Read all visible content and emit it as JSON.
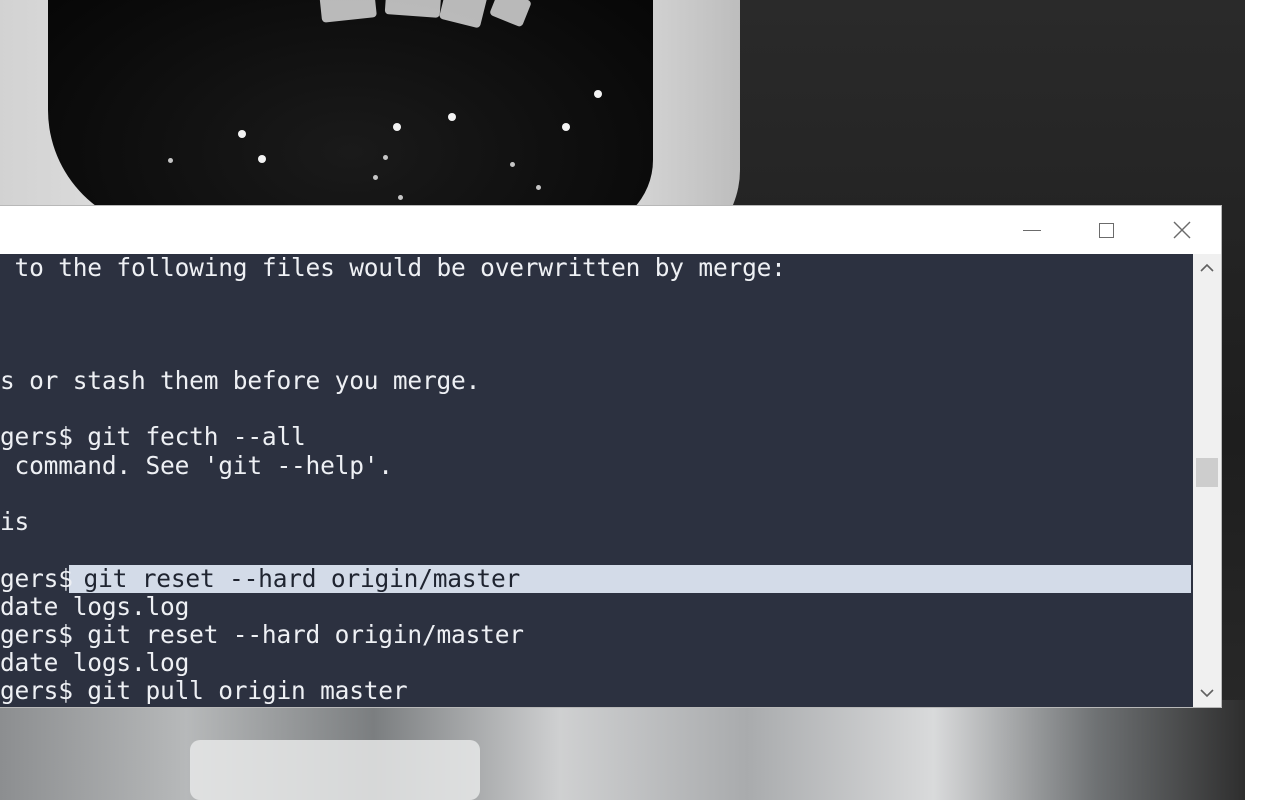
{
  "wallpaper": {
    "subject": "astronaut-helmet"
  },
  "terminal": {
    "window_controls": {
      "minimize_icon": "minimize-icon",
      "maximize_icon": "maximize-icon",
      "close_icon": "close-icon"
    },
    "lines": [
      " to the following files would be overwritten by merge:",
      "",
      "",
      "s or stash them before you merge.",
      "",
      "gers$ git fecth --all",
      " command. See 'git --help'.",
      "",
      "is",
      "",
      "gers$",
      "date logs.log",
      "gers$ git reset --hard origin/master",
      "date logs.log",
      "gers$ git pull origin master"
    ],
    "highlighted_text": " git reset --hard origin/master",
    "colors": {
      "background": "#2c3140",
      "text": "#eef0f4",
      "highlight": "#d3dbe8"
    }
  },
  "scrollbar": {
    "up_icon": "chevron-up-icon",
    "down_icon": "chevron-down-icon"
  }
}
